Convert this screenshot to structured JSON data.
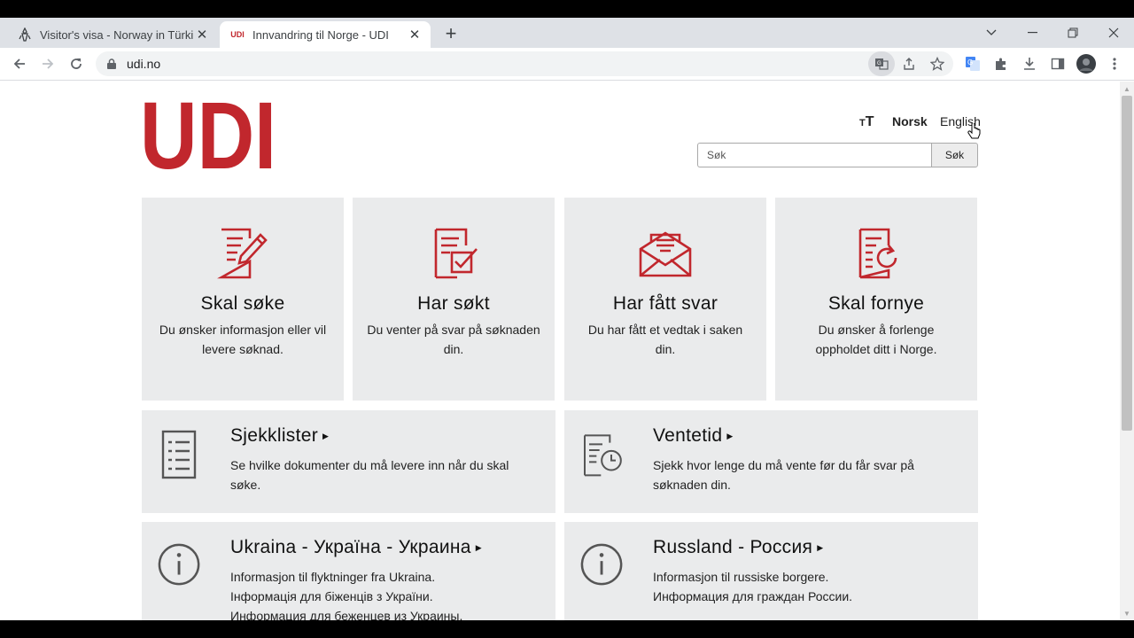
{
  "browser": {
    "tabs": [
      {
        "title": "Visitor's visa - Norway in Türkiye",
        "active": false
      },
      {
        "title": "Innvandring til Norge - UDI",
        "favicon_text": "UDI",
        "active": true
      }
    ],
    "url": "udi.no"
  },
  "site": {
    "logo_text": "UDI",
    "brand_color": "#c1272d",
    "lang": {
      "text_size_icon": "ᴛT",
      "norsk": "Norsk",
      "english": "English"
    },
    "search": {
      "placeholder": "Søk",
      "button": "Søk"
    }
  },
  "cards": [
    {
      "title": "Skal søke",
      "text": "Du ønsker informasjon eller vil levere søknad.",
      "icon": "form-edit-icon"
    },
    {
      "title": "Har søkt",
      "text": "Du venter på svar på søknaden din.",
      "icon": "form-check-icon"
    },
    {
      "title": "Har fått svar",
      "text": "Du har fått et vedtak i saken din.",
      "icon": "envelope-open-icon"
    },
    {
      "title": "Skal fornye",
      "text": "Du ønsker å forlenge oppholdet ditt i Norge.",
      "icon": "form-renew-icon"
    }
  ],
  "wide": [
    {
      "title": "Sjekklister",
      "text": "Se hvilke dokumenter du må levere inn når du skal søke.",
      "icon": "checklist-icon"
    },
    {
      "title": "Ventetid",
      "text": "Sjekk hvor lenge du må vente før du får svar på søknaden din.",
      "icon": "document-clock-icon"
    },
    {
      "title": "Ukraina - Україна - Украина",
      "lines": [
        "Informasjon til flyktninger fra Ukraina.",
        "Інформація для біженців з України.",
        "Информация для беженцев из Украины."
      ],
      "icon": "info-icon"
    },
    {
      "title": "Russland - Россия",
      "lines": [
        "Informasjon til russiske borgere.",
        "Информация для граждан России."
      ],
      "icon": "info-icon"
    }
  ]
}
